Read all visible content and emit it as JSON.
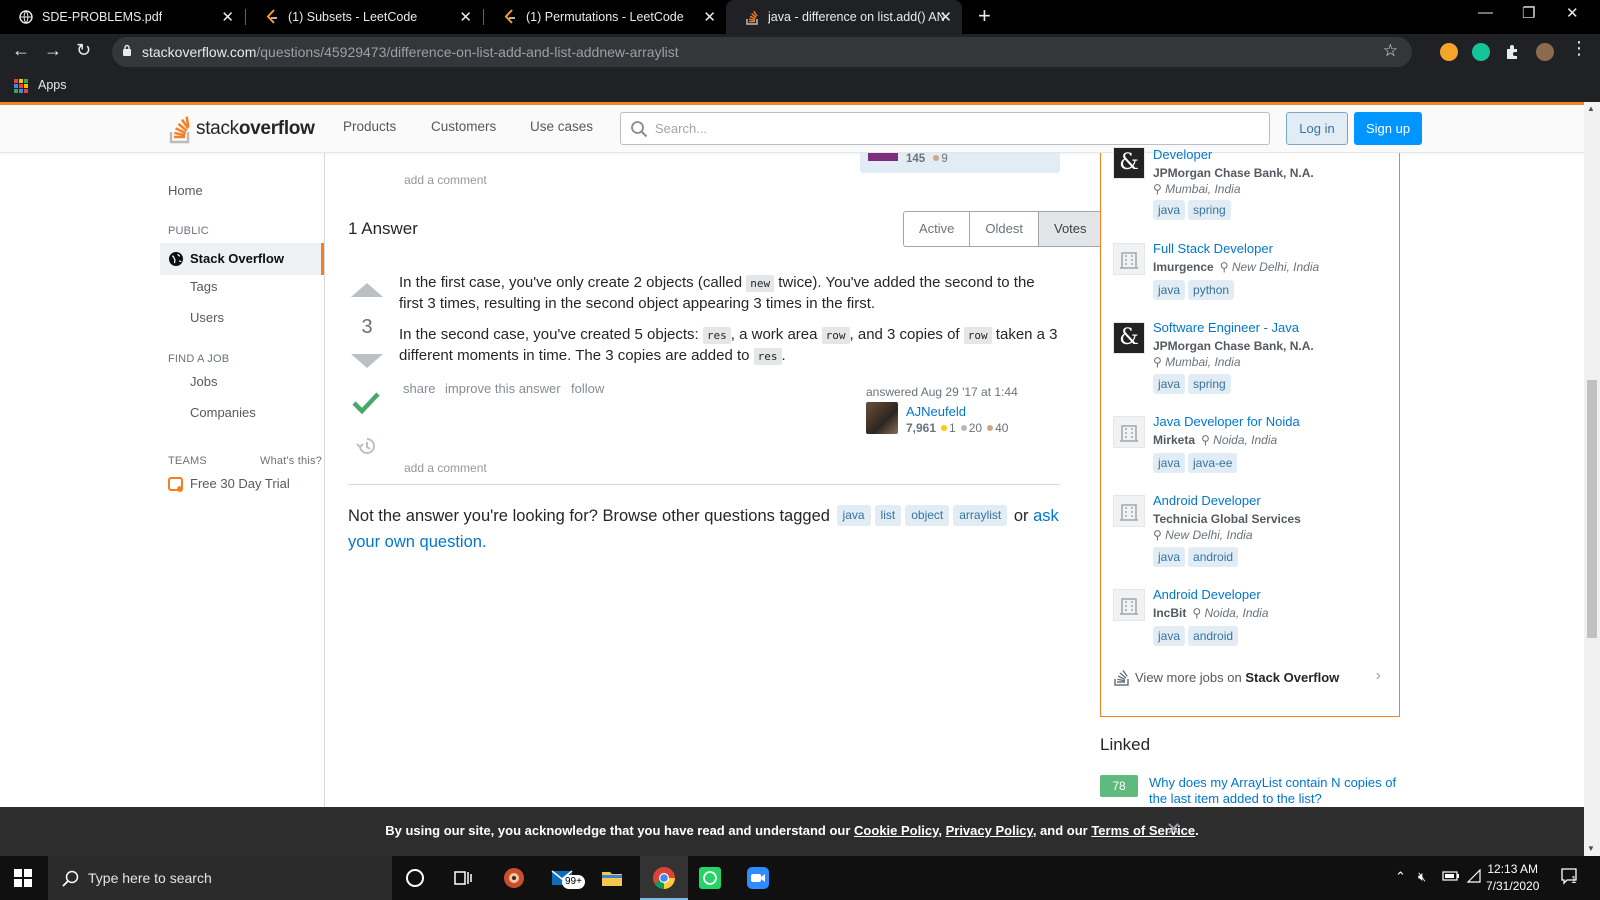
{
  "browser": {
    "tabs": [
      {
        "title": "SDE-PROBLEMS.pdf",
        "icon": "globe-icon"
      },
      {
        "title": "(1) Subsets - LeetCode",
        "icon": "leetcode-icon"
      },
      {
        "title": "(1) Permutations - LeetCode",
        "icon": "leetcode-icon"
      },
      {
        "title": "java - difference on list.add() AN",
        "icon": "stackoverflow-icon",
        "active": true
      }
    ],
    "url_host": "stackoverflow.com",
    "url_path": "/questions/45929473/difference-on-list-add-and-list-addnew-arraylist",
    "bookmarks": {
      "apps_label": "Apps"
    }
  },
  "so_header": {
    "logo_light": "stack",
    "logo_bold": "overflow",
    "nav": [
      "Products",
      "Customers",
      "Use cases"
    ],
    "search_placeholder": "Search...",
    "login": "Log in",
    "signup": "Sign up"
  },
  "sidebar": {
    "home": "Home",
    "public_heading": "PUBLIC",
    "stack_overflow": "Stack Overflow",
    "tags": "Tags",
    "users": "Users",
    "find_job_heading": "FIND A JOB",
    "jobs": "Jobs",
    "companies": "Companies",
    "teams_heading": "TEAMS",
    "whats_this": "What's this?",
    "trial": "Free 30 Day Trial"
  },
  "question": {
    "prev_rep": "145",
    "prev_bronze": "9",
    "add_comment": "add a comment"
  },
  "answers": {
    "heading": "1 Answer",
    "sort": [
      "Active",
      "Oldest",
      "Votes"
    ],
    "selected_sort": "Votes"
  },
  "answer": {
    "votes": "3",
    "accepted": true,
    "p1_a": "In the first case, you've only create 2 objects (called ",
    "p1_code": "new",
    "p1_b": " twice). You've added the second to the first 3 times, resulting in the second object appearing 3 times in the first.",
    "p2_a": "In the second case, you've created 5 objects: ",
    "p2_code1": "res",
    "p2_b": ", a work area ",
    "p2_code2": "row",
    "p2_c": ", and 3 copies of ",
    "p2_code3": "row",
    "p2_d": " taken a 3 different moments in time. The 3 copies are added to ",
    "p2_code4": "res",
    "p2_e": ".",
    "menu": [
      "share",
      "improve this answer",
      "follow"
    ],
    "answered": "answered Aug 29 '17 at 1:44",
    "user": "AJNeufeld",
    "rep": "7,961",
    "gold": "1",
    "silver": "20",
    "bronze": "40",
    "add_comment": "add a comment"
  },
  "browse": {
    "text": "Not the answer you're looking for? Browse other questions tagged",
    "tags": [
      "java",
      "list",
      "object",
      "arraylist"
    ],
    "or": "or",
    "ask": "ask your own question",
    "end": "."
  },
  "jobs": {
    "items": [
      {
        "title": "Developer",
        "company": "JPMorgan Chase Bank, N.A.",
        "location": "Mumbai, India",
        "tags": [
          "java",
          "spring"
        ],
        "logo": "ampersand"
      },
      {
        "title": "Full Stack Developer",
        "company": "Imurgence",
        "location": "New Delhi, India",
        "tags": [
          "java",
          "python"
        ],
        "logo": "building"
      },
      {
        "title": "Software Engineer - Java",
        "company": "JPMorgan Chase Bank, N.A.",
        "location": "Mumbai, India",
        "tags": [
          "java",
          "spring"
        ],
        "logo": "ampersand"
      },
      {
        "title": "Java Developer for Noida",
        "company": "Mirketa",
        "location": "Noida, India",
        "tags": [
          "java",
          "java-ee"
        ],
        "logo": "building"
      },
      {
        "title": "Android Developer",
        "company": "Technicia Global Services",
        "location": "New Delhi, India",
        "tags": [
          "java",
          "android"
        ],
        "logo": "building"
      },
      {
        "title": "Android Developer",
        "company": "IncBit",
        "location": "Noida, India",
        "tags": [
          "java",
          "android"
        ],
        "logo": "building"
      }
    ],
    "more_prefix": "View more jobs on",
    "more_bold": "Stack Overflow"
  },
  "linked": {
    "heading": "Linked",
    "count": "78",
    "title": "Why does my ArrayList contain N copies of the last item added to the list?"
  },
  "cookie": {
    "prefix": "By using our site, you acknowledge that you have read and understand our",
    "cookie_policy": "Cookie Policy",
    "sep": ",",
    "privacy_policy": "Privacy Policy",
    "and": ", and our",
    "terms": "Terms of Service",
    "end": "."
  },
  "taskbar": {
    "search_placeholder": "Type here to search",
    "mail_badge": "99+",
    "time": "12:13 AM",
    "date": "7/31/2020",
    "notif_count": "1"
  },
  "colors": {
    "accent": "#f48024",
    "link": "#0077cc",
    "accepted": "#48a868",
    "tag_bg": "#e1ecf4"
  }
}
